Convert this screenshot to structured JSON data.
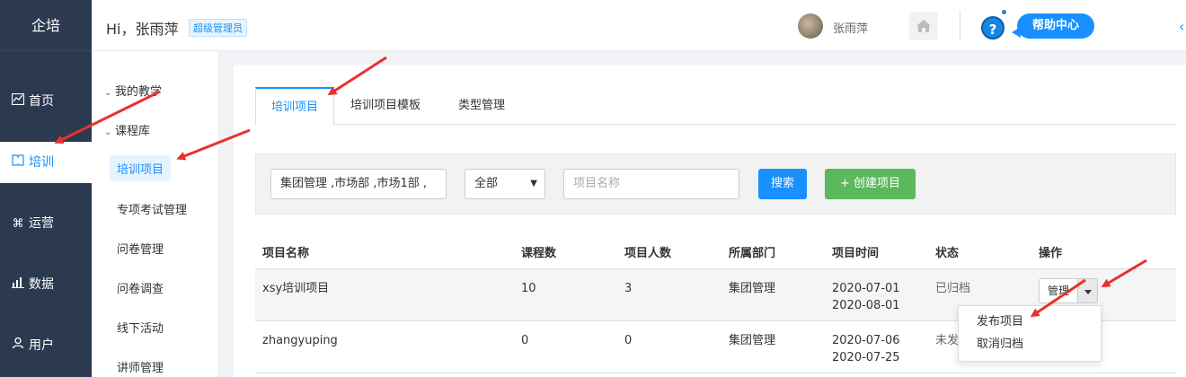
{
  "app": {
    "logo": "企培"
  },
  "leftnav": {
    "items": [
      {
        "label": "首页",
        "icon": "chart-line-icon"
      },
      {
        "label": "培训",
        "icon": "book-icon",
        "active": true
      },
      {
        "label": "运营",
        "icon": "command-icon"
      },
      {
        "label": "数据",
        "icon": "bar-chart-icon"
      },
      {
        "label": "用户",
        "icon": "user-icon"
      }
    ]
  },
  "header": {
    "greeting": "Hi，张雨萍",
    "role": "超级管理员",
    "username": "张雨萍",
    "help_label": "帮助中心",
    "help_icon": "?"
  },
  "subnav": {
    "groups": [
      {
        "label": "我的教学"
      },
      {
        "label": "课程库"
      }
    ],
    "items": [
      {
        "label": "培训项目",
        "active": true
      },
      {
        "label": "专项考试管理"
      },
      {
        "label": "问卷管理"
      },
      {
        "label": "问卷调查"
      },
      {
        "label": "线下活动"
      },
      {
        "label": "讲师管理"
      }
    ]
  },
  "tabs": [
    {
      "label": "培训项目",
      "active": true
    },
    {
      "label": "培训项目模板"
    },
    {
      "label": "类型管理"
    }
  ],
  "filters": {
    "department_value": "集团管理 ,市场部 ,市场1部 ,",
    "status_value": "全部",
    "name_placeholder": "项目名称",
    "search_label": "搜索",
    "create_label": "+ 创建项目"
  },
  "table": {
    "columns": [
      "项目名称",
      "课程数",
      "项目人数",
      "所属部门",
      "项目时间",
      "状态",
      "操作"
    ],
    "rows": [
      {
        "name": "xsy培训项目",
        "courses": "10",
        "people": "3",
        "dept": "集团管理",
        "start": "2020-07-01",
        "end": "2020-08-01",
        "status": "已归档",
        "action": "管理"
      },
      {
        "name": "zhangyuping",
        "courses": "0",
        "people": "0",
        "dept": "集团管理",
        "start": "2020-07-06",
        "end": "2020-07-25",
        "status": "未发",
        "action": ""
      }
    ]
  },
  "dropdown": {
    "items": [
      "发布项目",
      "取消归档"
    ]
  },
  "colors": {
    "nav_bg": "#2b3a4f",
    "accent": "#1890ff",
    "create_green": "#5cb85c",
    "annotation_red": "#e8322c"
  }
}
